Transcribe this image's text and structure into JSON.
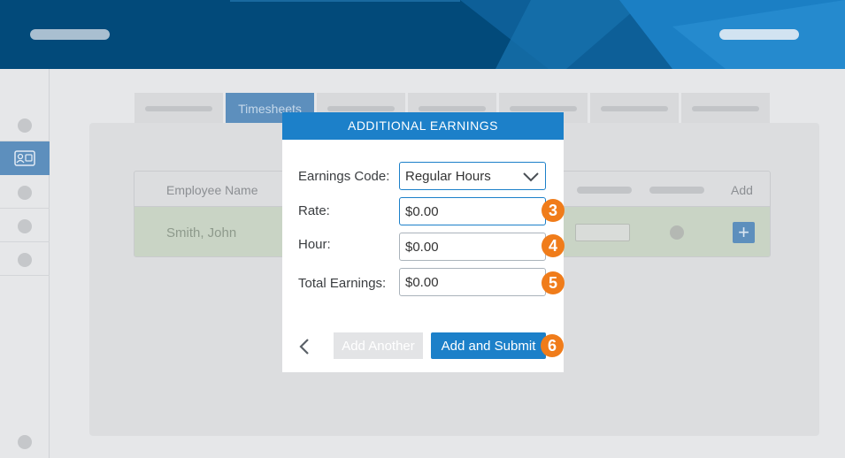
{
  "background": {
    "active_tab_label": "Timesheets",
    "table": {
      "header_name": "Employee Name",
      "header_add": "Add",
      "row_name": "Smith, John",
      "add_icon": "plus-icon"
    },
    "sidebar_active_icon": "id-card-icon"
  },
  "modal": {
    "title": "ADDITIONAL EARNINGS",
    "fields": {
      "earnings_code": {
        "label": "Earnings Code:",
        "value": "Regular Hours"
      },
      "rate": {
        "label": "Rate:",
        "value": "$0.00",
        "badge": "3"
      },
      "hour": {
        "label": "Hour:",
        "value": "$0.00",
        "badge": "4"
      },
      "total": {
        "label": "Total Earnings:",
        "value": "$0.00",
        "badge": "5"
      }
    },
    "buttons": {
      "back_icon": "chevron-left-icon",
      "add_another": "Add Another",
      "add_and_submit": "Add and Submit",
      "submit_badge": "6"
    }
  },
  "colors": {
    "header": "#024a7a",
    "accent": "#1c80c9",
    "badge": "#f07c1a"
  }
}
